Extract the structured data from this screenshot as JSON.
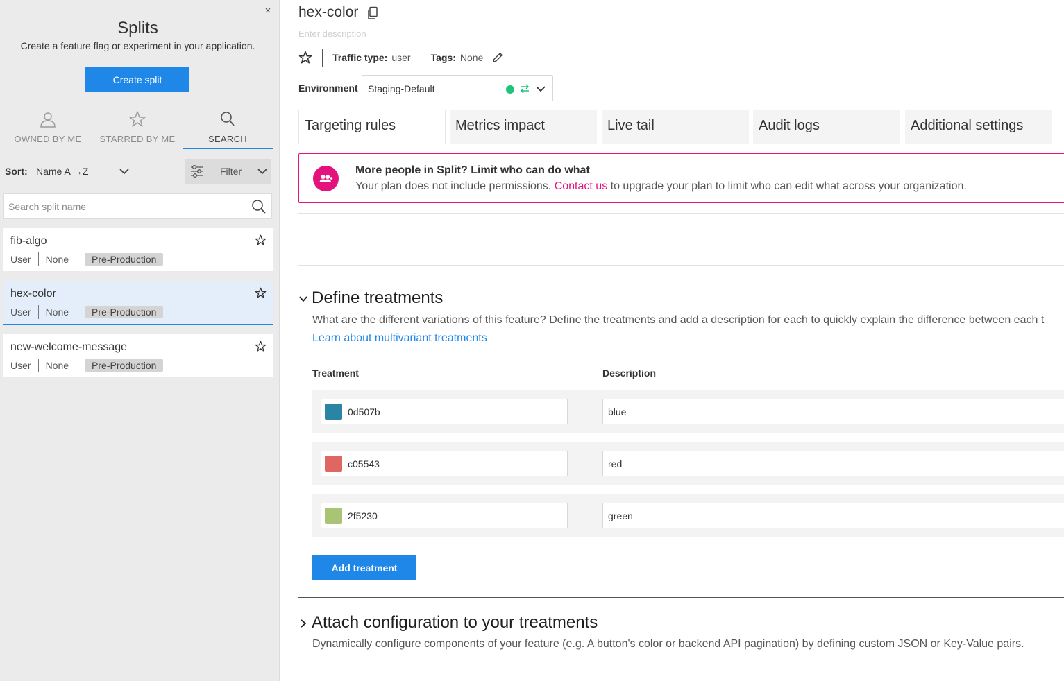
{
  "sidebar": {
    "close_glyph": "×",
    "title": "Splits",
    "subtitle": "Create a feature flag or experiment in your application.",
    "create_button": "Create split",
    "tabs": [
      {
        "label": "OWNED BY ME",
        "icon": "user-icon"
      },
      {
        "label": "STARRED BY ME",
        "icon": "star-icon"
      },
      {
        "label": "SEARCH",
        "icon": "search-icon",
        "active": true
      }
    ],
    "sort": {
      "label": "Sort:",
      "value": "Name A →Z"
    },
    "filter": {
      "label": "Filter"
    },
    "search": {
      "placeholder": "Search split name",
      "value": ""
    },
    "splits": [
      {
        "name": "fib-algo",
        "traffic": "User",
        "owner": "None",
        "tag": "Pre-Production",
        "selected": false
      },
      {
        "name": "hex-color",
        "traffic": "User",
        "owner": "None",
        "tag": "Pre-Production",
        "selected": true
      },
      {
        "name": "new-welcome-message",
        "traffic": "User",
        "owner": "None",
        "tag": "Pre-Production",
        "selected": false
      }
    ]
  },
  "main": {
    "title": "hex-color",
    "description_placeholder": "Enter description",
    "traffic_type": {
      "label": "Traffic type:",
      "value": "user"
    },
    "tags": {
      "label": "Tags:",
      "value": "None"
    },
    "environment": {
      "label": "Environment",
      "value": "Staging-Default",
      "status_color": "#1fc37c"
    },
    "tabs": [
      "Targeting rules",
      "Metrics impact",
      "Live tail",
      "Audit logs",
      "Additional settings"
    ],
    "active_tab": "Targeting rules",
    "upsell": {
      "title": "More people in Split? Limit who can do what",
      "text_before": "Your plan does not include permissions. ",
      "link": "Contact us",
      "text_after": " to upgrade your plan to limit who can edit what across your organization."
    },
    "define_treatments": {
      "title": "Define treatments",
      "description": "What are the different variations of this feature? Define the treatments and add a description for each to quickly explain the difference between each t",
      "learn_link": "Learn about multivariant treatments",
      "col_treatment": "Treatment",
      "col_description": "Description",
      "treatments": [
        {
          "name": "0d507b",
          "color": "#2a84a4",
          "description": "blue"
        },
        {
          "name": "c05543",
          "color": "#e06663",
          "description": "red"
        },
        {
          "name": "2f5230",
          "color": "#a8c474",
          "description": "green"
        }
      ],
      "add_button": "Add treatment"
    },
    "attach_config": {
      "title": "Attach configuration to your treatments",
      "description": "Dynamically configure components of your feature (e.g. A button's color or backend API pagination) by defining custom JSON or Key-Value pairs."
    }
  },
  "colors": {
    "accent": "#1f87e8",
    "brand_pink": "#e4137c",
    "env_green": "#1fc37c"
  }
}
